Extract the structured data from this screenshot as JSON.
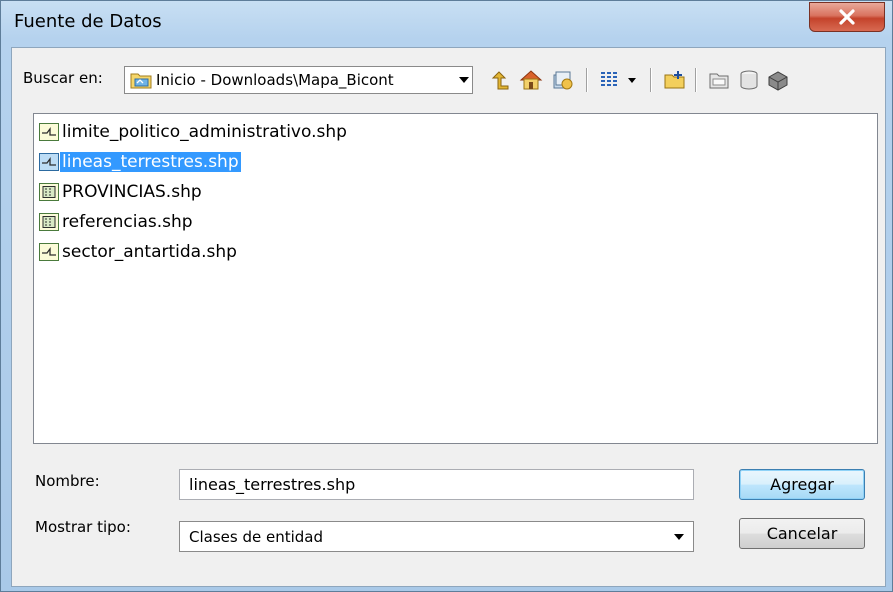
{
  "window": {
    "title": "Fuente de Datos"
  },
  "lookin": {
    "label": "Buscar en:",
    "path": "Inicio - Downloads\\Mapa_Bicont"
  },
  "toolbar": {
    "icons": [
      "up-folder-icon",
      "home-icon",
      "catalog-icon",
      "view-menu-icon",
      "new-folder-icon",
      "connect-folder-icon",
      "catalog-view-icon",
      "toolbox-icon"
    ]
  },
  "files": [
    {
      "name": "limite_politico_administrativo.shp",
      "type": "line",
      "selected": false
    },
    {
      "name": "lineas_terrestres.shp",
      "type": "line",
      "selected": true
    },
    {
      "name": "PROVINCIAS.shp",
      "type": "polygon",
      "selected": false
    },
    {
      "name": "referencias.shp",
      "type": "polygon",
      "selected": false
    },
    {
      "name": "sector_antartida.shp",
      "type": "line",
      "selected": false
    }
  ],
  "name_field": {
    "label": "Nombre:",
    "value": "lineas_terrestres.shp"
  },
  "type_field": {
    "label": "Mostrar tipo:",
    "value": "Clases de entidad"
  },
  "buttons": {
    "add": "Agregar",
    "cancel": "Cancelar"
  }
}
